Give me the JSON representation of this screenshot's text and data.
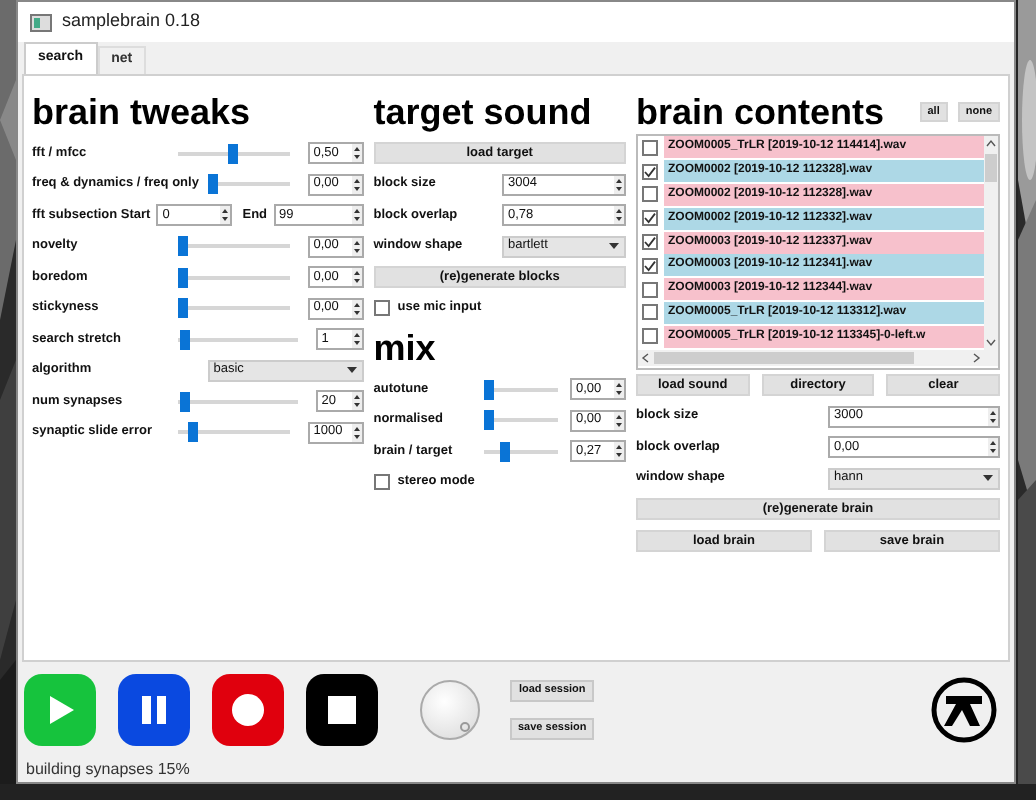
{
  "window": {
    "title": "samplebrain 0.18"
  },
  "tabs": [
    {
      "label": "search",
      "selected": true
    },
    {
      "label": "net",
      "selected": false
    }
  ],
  "brain_tweaks": {
    "title": "brain tweaks",
    "rows": [
      {
        "kind": "slider",
        "label": "fft / mfcc",
        "level": 0.5,
        "value": "0,50"
      },
      {
        "kind": "slider",
        "label": "freq & dynamics / freq only",
        "level": 0.0,
        "value": "0,00"
      },
      {
        "kind": "range",
        "label": "fft subsection Start",
        "start": "0",
        "end_label": "End",
        "end": "99"
      },
      {
        "kind": "slider",
        "label": "novelty",
        "level": 0.0,
        "value": "0,00"
      },
      {
        "kind": "slider",
        "label": "boredom",
        "level": 0.0,
        "value": "0,00"
      },
      {
        "kind": "slider",
        "label": "stickyness",
        "level": 0.0,
        "value": "0,00"
      },
      {
        "kind": "slider",
        "label": "search stretch",
        "level": 0.02,
        "value": "1"
      },
      {
        "kind": "dropdown",
        "label": "algorithm",
        "value": "basic"
      },
      {
        "kind": "slider",
        "label": "num synapses",
        "level": 0.02,
        "value": "20"
      },
      {
        "kind": "slider",
        "label": "synaptic slide error",
        "level": 0.1,
        "value": "1000"
      }
    ]
  },
  "target_sound": {
    "title": "target sound",
    "rows": [
      {
        "kind": "button",
        "label": "load target"
      },
      {
        "kind": "spin",
        "label": "block size",
        "value": "3004"
      },
      {
        "kind": "spin",
        "label": "block overlap",
        "value": "0,78"
      },
      {
        "kind": "dropdown",
        "label": "window shape",
        "value": "bartlett"
      },
      {
        "kind": "button",
        "label": "(re)generate blocks"
      },
      {
        "kind": "checkbox",
        "label": "use mic input",
        "checked": false
      }
    ]
  },
  "mix": {
    "title": "mix",
    "rows": [
      {
        "kind": "slider",
        "label": "autotune",
        "level": 0.0,
        "value": "0,00"
      },
      {
        "kind": "slider",
        "label": "normalised",
        "level": 0.0,
        "value": "0,00"
      },
      {
        "kind": "slider",
        "label": "brain / target",
        "level": 0.27,
        "value": "0,27"
      },
      {
        "kind": "checkbox",
        "label": "stereo mode",
        "checked": false
      }
    ]
  },
  "brain_contents": {
    "title": "brain contents",
    "header_buttons": [
      "all",
      "none"
    ],
    "files": [
      {
        "name": "ZOOM0005_TrLR [2019-10-12 114414].wav",
        "checked": false,
        "color": "#f7c1cc"
      },
      {
        "name": "ZOOM0002 [2019-10-12 112328].wav",
        "checked": true,
        "color": "#add8e6"
      },
      {
        "name": "ZOOM0002 [2019-10-12 112328].wav",
        "checked": false,
        "color": "#f7c1cc"
      },
      {
        "name": "ZOOM0002 [2019-10-12 112332].wav",
        "checked": true,
        "color": "#add8e6"
      },
      {
        "name": "ZOOM0003 [2019-10-12 112337].wav",
        "checked": true,
        "color": "#f7c1cc"
      },
      {
        "name": "ZOOM0003 [2019-10-12 112341].wav",
        "checked": true,
        "color": "#add8e6"
      },
      {
        "name": "ZOOM0003 [2019-10-12 112344].wav",
        "checked": false,
        "color": "#f7c1cc"
      },
      {
        "name": "ZOOM0005_TrLR [2019-10-12 113312].wav",
        "checked": false,
        "color": "#add8e6"
      },
      {
        "name": "ZOOM0005_TrLR [2019-10-12 113345]-0-left.w",
        "checked": false,
        "color": "#f7c1cc"
      }
    ],
    "rows": [
      {
        "kind": "buttons",
        "labels": [
          "load sound",
          "directory",
          "clear"
        ]
      },
      {
        "kind": "spin",
        "label": "block size",
        "value": "3000"
      },
      {
        "kind": "spin",
        "label": "block overlap",
        "value": "0,00"
      },
      {
        "kind": "dropdown",
        "label": "window shape",
        "value": "hann"
      },
      {
        "kind": "button",
        "label": "(re)generate brain"
      },
      {
        "kind": "buttons",
        "labels": [
          "load brain",
          "save brain"
        ]
      }
    ]
  },
  "transport": [
    {
      "kind": "play"
    },
    {
      "kind": "pause"
    },
    {
      "kind": "record"
    },
    {
      "kind": "stop"
    }
  ],
  "session_buttons": [
    "load session",
    "save session"
  ],
  "status_bar": "building synapses 15%"
}
